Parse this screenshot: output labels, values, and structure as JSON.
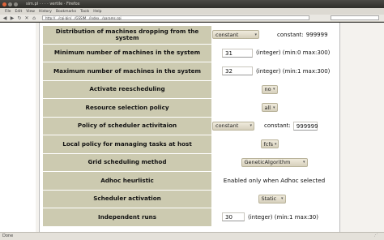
{
  "window": {
    "title": "sim.pl · · · · vertile · Firefox"
  },
  "menu": [
    "File",
    "Edit",
    "View",
    "History",
    "Bookmarks",
    "Tools",
    "Help"
  ],
  "toolbar": {
    "url": "http://.../cgi-bin/.../GSSIM.../index.../params.cgi"
  },
  "rows": [
    {
      "label": "Distribution of machines dropping from the system",
      "select": "constant",
      "text": "constant:",
      "value": "999999"
    },
    {
      "label": "Minimum number of machines in the system",
      "input": "31",
      "hint": "(integer) (min:0 max:300)"
    },
    {
      "label": "Maximum number of machines in the system",
      "input": "32",
      "hint": "(integer) (min:1 max:300)"
    },
    {
      "label": "Activate reescheduling",
      "select": "no"
    },
    {
      "label": "Resource selection policy",
      "select": "all"
    },
    {
      "label": "Policy of scheduler activitaion",
      "select": "constant",
      "text": "constant:",
      "value": "999999"
    },
    {
      "label": "Local policy for managing tasks at host",
      "select": "fcfs"
    },
    {
      "label": "Grid scheduling method",
      "select": "GeneticAlgorithm"
    },
    {
      "label": "Adhoc heurlistic",
      "text": "Enabled only when Adhoc selected"
    },
    {
      "label": "Scheduler activation",
      "select": "Static"
    },
    {
      "label": "Independent runs",
      "input": "30",
      "hint": "(integer) (min:1 max:30)"
    }
  ],
  "status": {
    "text": "Done"
  }
}
